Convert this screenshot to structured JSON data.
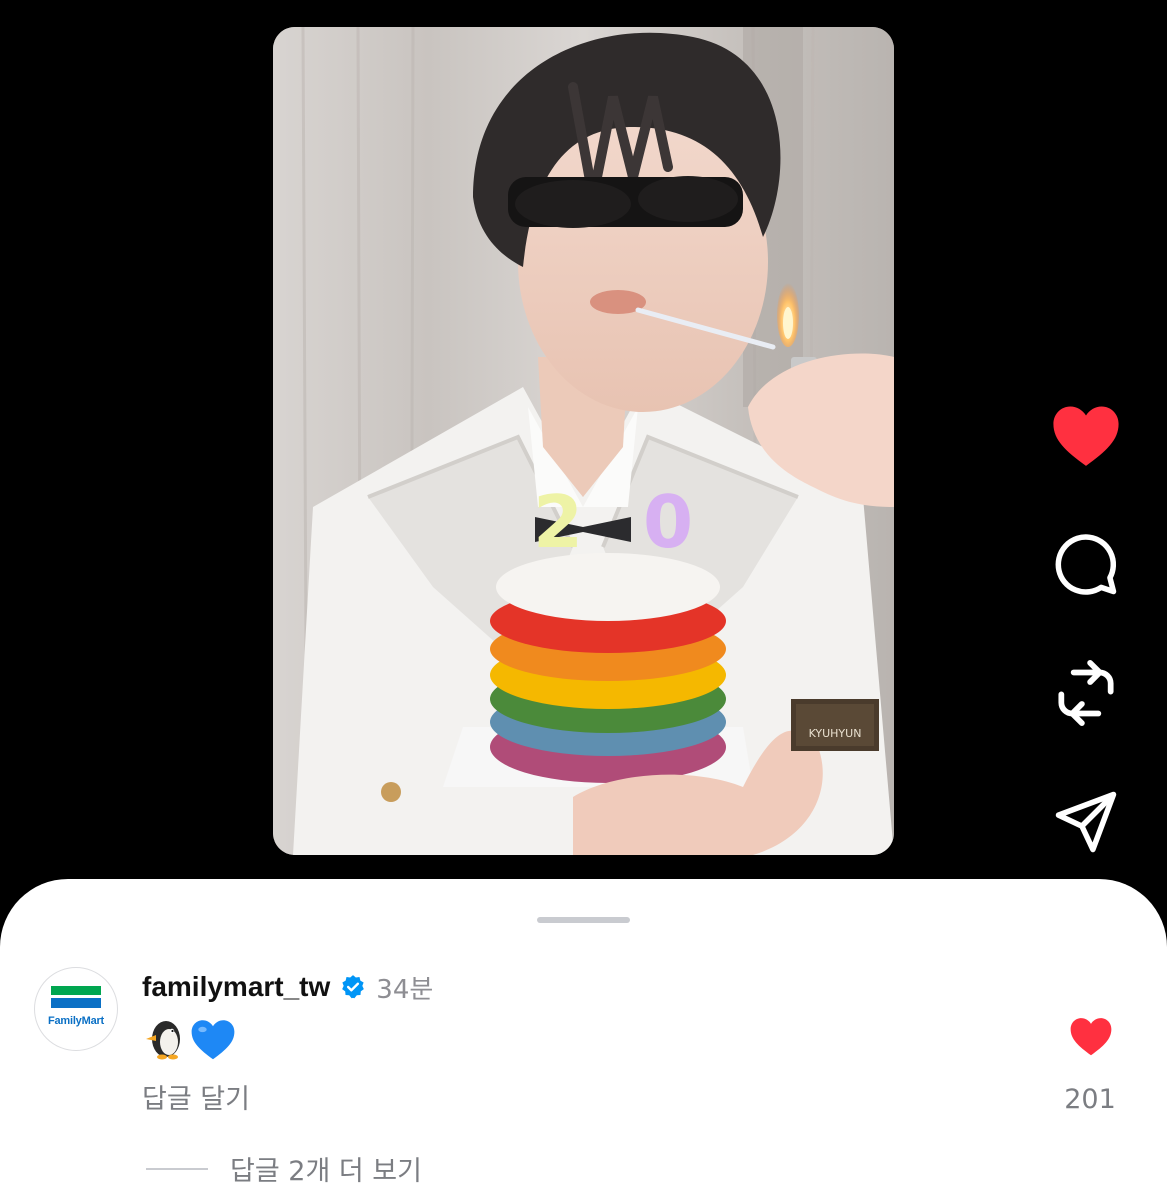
{
  "media": {
    "badge_text": "KYUHYUN",
    "candle_digits": [
      "2",
      "0"
    ]
  },
  "actions": [
    {
      "name": "like",
      "icon": "heart-filled-icon",
      "color": "#ff3040"
    },
    {
      "name": "comment",
      "icon": "speech-bubble-icon",
      "color": "#ffffff"
    },
    {
      "name": "repost",
      "icon": "repost-icon",
      "color": "#ffffff"
    },
    {
      "name": "share",
      "icon": "paper-plane-icon",
      "color": "#ffffff"
    }
  ],
  "comment": {
    "avatar_brand": "FamilyMart",
    "username": "familymart_tw",
    "verified": true,
    "time": "34분",
    "body_emojis": [
      "penguin-emoji",
      "blue-heart-emoji"
    ],
    "reply_label": "답글 달기",
    "like_count": "201",
    "more_replies_label": "답글 2개 더 보기"
  },
  "colors": {
    "like_red": "#ff3040",
    "verified_blue": "#0095f6",
    "muted_text": "#7b7d82"
  }
}
